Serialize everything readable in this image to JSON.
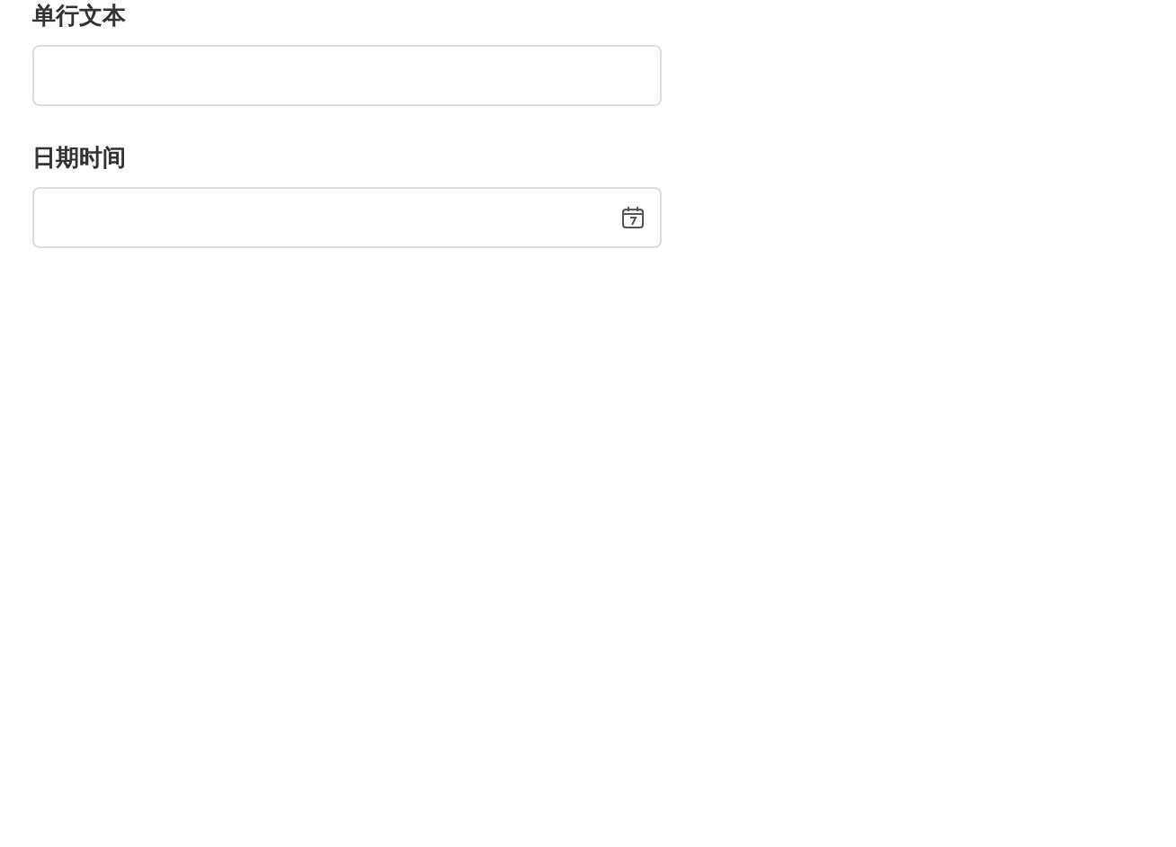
{
  "fields": [
    {
      "kind": "text",
      "label": "单行文本"
    },
    {
      "kind": "datetime",
      "label": "日期时间"
    }
  ]
}
